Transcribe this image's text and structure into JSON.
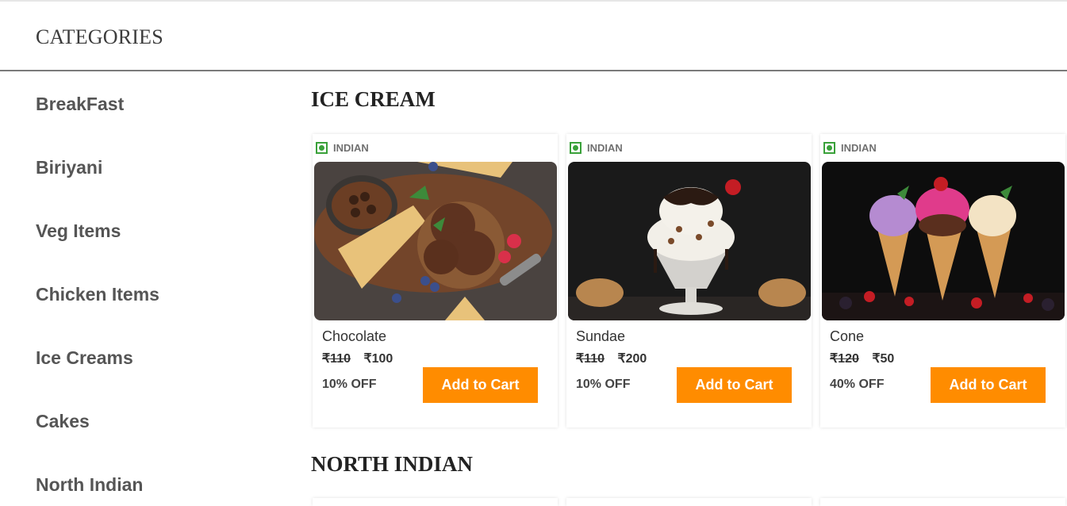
{
  "header": {
    "title": "CATEGORIES"
  },
  "sidebar": {
    "items": [
      {
        "label": "BreakFast"
      },
      {
        "label": "Biriyani"
      },
      {
        "label": "Veg Items"
      },
      {
        "label": "Chicken Items"
      },
      {
        "label": "Ice Creams"
      },
      {
        "label": "Cakes"
      },
      {
        "label": "North Indian"
      }
    ]
  },
  "main": {
    "sections": [
      {
        "title": "ICE CREAM",
        "cards": [
          {
            "cuisine": "INDIAN",
            "name": "Chocolate",
            "old_price": "₹110",
            "price": "₹100",
            "discount": "10% OFF",
            "button": "Add to Cart",
            "image_icon": "chocolate-ice-cream-image"
          },
          {
            "cuisine": "INDIAN",
            "name": "Sundae",
            "old_price": "₹110",
            "price": "₹200",
            "discount": "10% OFF",
            "button": "Add to Cart",
            "image_icon": "sundae-image"
          },
          {
            "cuisine": "INDIAN",
            "name": "Cone",
            "old_price": "₹120",
            "price": "₹50",
            "discount": "40% OFF",
            "button": "Add to Cart",
            "image_icon": "ice-cream-cones-image"
          }
        ]
      },
      {
        "title": "NORTH INDIAN"
      }
    ]
  },
  "colors": {
    "accent": "#ff8c00",
    "veg": "#3aa13a",
    "divider": "#7a7a7a"
  }
}
